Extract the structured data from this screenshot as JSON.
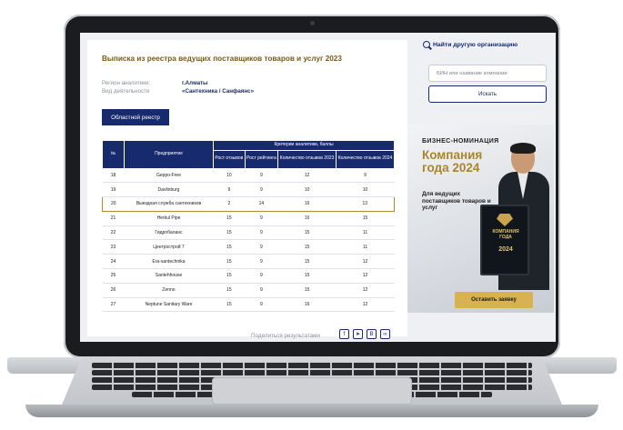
{
  "left": {
    "title": "Выписка из реестра ведущих поставщиков товаров и услуг 2023",
    "meta": [
      {
        "label": "Регион аналитики:",
        "value": "г.Алматы"
      },
      {
        "label": "Вид деятельности",
        "value": "«Сантехника / Санфаянс»"
      }
    ],
    "regional_button": "Областной реестр",
    "table": {
      "col_num": "№",
      "col_company": "Предприятие",
      "col_group": "Критерии аналитики, баллы",
      "cols": [
        "Рост отзывов",
        "Рост рейтинга",
        "Количество отзывов 2023",
        "Количество отзывов 2024"
      ],
      "rows": [
        {
          "n": "18",
          "name": "Geppo-Free",
          "v": [
            "10",
            "9",
            "12",
            "9"
          ]
        },
        {
          "n": "19",
          "name": "Davlinburg",
          "v": [
            "9",
            "9",
            "10",
            "10"
          ]
        },
        {
          "n": "20",
          "name": "Выездная служба сантехников",
          "v": [
            "2",
            "14",
            "16",
            "13"
          ],
          "highlight": true
        },
        {
          "n": "21",
          "name": "Herkul Pipe",
          "v": [
            "15",
            "9",
            "16",
            "15"
          ]
        },
        {
          "n": "22",
          "name": "Гидробаланс",
          "v": [
            "15",
            "9",
            "15",
            "11"
          ]
        },
        {
          "n": "23",
          "name": "Центрострой 7",
          "v": [
            "15",
            "9",
            "15",
            "11"
          ]
        },
        {
          "n": "24",
          "name": "Era-santechnika",
          "v": [
            "15",
            "9",
            "15",
            "12"
          ]
        },
        {
          "n": "25",
          "name": "Santehhouse",
          "v": [
            "15",
            "9",
            "15",
            "12"
          ]
        },
        {
          "n": "26",
          "name": "Zenno",
          "v": [
            "15",
            "9",
            "15",
            "12"
          ]
        },
        {
          "n": "27",
          "name": "Neptune Sanitary Ware",
          "v": [
            "15",
            "9",
            "16",
            "12"
          ]
        }
      ]
    },
    "share_label": "Поделиться результатами",
    "share_icons": [
      "facebook-icon",
      "telegram-icon",
      "vk-icon",
      "link-icon"
    ]
  },
  "right": {
    "find_label": "Найти другую организацию",
    "search_placeholder": "БИН или название компании",
    "search_button": "Искать",
    "banner": {
      "kicker": "БИЗНЕС-НОМИНАЦИЯ",
      "headline": "Компания года 2024",
      "subline": "Для ведущих поставщиков товаров и услуг",
      "plaque_title": "КОМПАНИЯ ГОДА",
      "plaque_year": "2024",
      "cta": "Оставить заявку"
    }
  },
  "colors": {
    "navy": "#172a6e",
    "gold": "#a9862d",
    "title_brown": "#7a5a14"
  }
}
